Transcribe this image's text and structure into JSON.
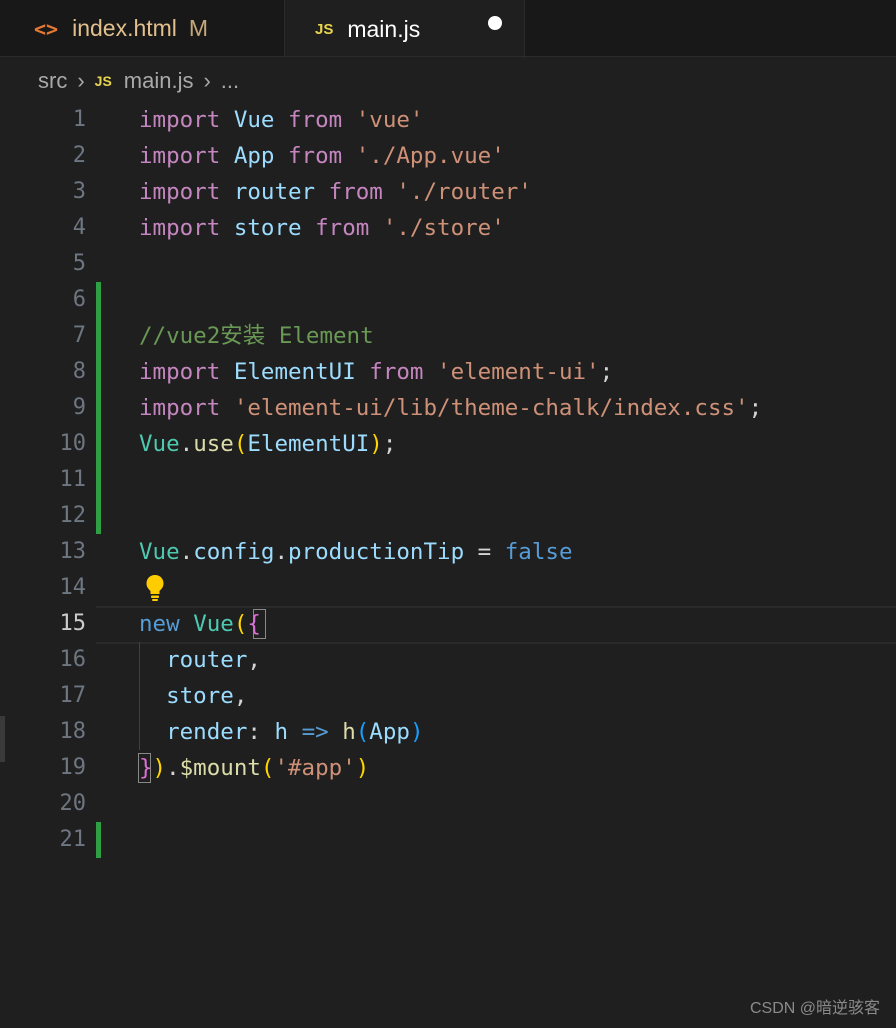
{
  "tabs": [
    {
      "icon": "html-icon",
      "glyph": "<>",
      "name": "index.html",
      "status": "M",
      "active": false
    },
    {
      "icon": "js-icon",
      "glyph": "JS",
      "name": "main.js",
      "dirty": true,
      "active": true
    }
  ],
  "breadcrumb": {
    "folder": "src",
    "js_glyph": "JS",
    "file": "main.js",
    "more": "..."
  },
  "editor": {
    "current_line": 15,
    "line_numbers": [
      "1",
      "2",
      "3",
      "4",
      "5",
      "6",
      "7",
      "8",
      "9",
      "10",
      "11",
      "12",
      "13",
      "14",
      "15",
      "16",
      "17",
      "18",
      "19",
      "20",
      "21"
    ],
    "lines": [
      [
        {
          "t": "import",
          "c": "kw"
        },
        {
          "t": " "
        },
        {
          "t": "Vue",
          "c": "id"
        },
        {
          "t": " "
        },
        {
          "t": "from",
          "c": "kw"
        },
        {
          "t": " "
        },
        {
          "t": "'vue'",
          "c": "str"
        }
      ],
      [
        {
          "t": "import",
          "c": "kw"
        },
        {
          "t": " "
        },
        {
          "t": "App",
          "c": "id"
        },
        {
          "t": " "
        },
        {
          "t": "from",
          "c": "kw"
        },
        {
          "t": " "
        },
        {
          "t": "'./App.vue'",
          "c": "str"
        }
      ],
      [
        {
          "t": "import",
          "c": "kw"
        },
        {
          "t": " "
        },
        {
          "t": "router",
          "c": "id"
        },
        {
          "t": " "
        },
        {
          "t": "from",
          "c": "kw"
        },
        {
          "t": " "
        },
        {
          "t": "'./router'",
          "c": "str"
        }
      ],
      [
        {
          "t": "import",
          "c": "kw"
        },
        {
          "t": " "
        },
        {
          "t": "store",
          "c": "id"
        },
        {
          "t": " "
        },
        {
          "t": "from",
          "c": "kw"
        },
        {
          "t": " "
        },
        {
          "t": "'./store'",
          "c": "str"
        }
      ],
      [],
      [],
      [
        {
          "t": "//vue2安装 Element",
          "c": "cm"
        }
      ],
      [
        {
          "t": "import",
          "c": "kw"
        },
        {
          "t": " "
        },
        {
          "t": "ElementUI",
          "c": "id"
        },
        {
          "t": " "
        },
        {
          "t": "from",
          "c": "kw"
        },
        {
          "t": " "
        },
        {
          "t": "'element-ui'",
          "c": "str"
        },
        {
          "t": ";"
        }
      ],
      [
        {
          "t": "import",
          "c": "kw"
        },
        {
          "t": " "
        },
        {
          "t": "'element-ui/lib/theme-chalk/index.css'",
          "c": "str"
        },
        {
          "t": ";"
        }
      ],
      [
        {
          "t": "Vue",
          "c": "cls"
        },
        {
          "t": "."
        },
        {
          "t": "use",
          "c": "fn"
        },
        {
          "t": "(",
          "c": "br1"
        },
        {
          "t": "ElementUI",
          "c": "id"
        },
        {
          "t": ")",
          "c": "br1"
        },
        {
          "t": ";"
        }
      ],
      [],
      [],
      [
        {
          "t": "Vue",
          "c": "cls"
        },
        {
          "t": "."
        },
        {
          "t": "config",
          "c": "id"
        },
        {
          "t": "."
        },
        {
          "t": "productionTip",
          "c": "id"
        },
        {
          "t": " = "
        },
        {
          "t": "false",
          "c": "blue"
        }
      ],
      [],
      [
        {
          "t": "new",
          "c": "blue"
        },
        {
          "t": " "
        },
        {
          "t": "Vue",
          "c": "cls"
        },
        {
          "t": "(",
          "c": "br1"
        },
        {
          "t": "{",
          "c": "br2"
        }
      ],
      [
        {
          "t": "  "
        },
        {
          "t": "router",
          "c": "id"
        },
        {
          "t": ","
        }
      ],
      [
        {
          "t": "  "
        },
        {
          "t": "store",
          "c": "id"
        },
        {
          "t": ","
        }
      ],
      [
        {
          "t": "  "
        },
        {
          "t": "render",
          "c": "id"
        },
        {
          "t": ": "
        },
        {
          "t": "h",
          "c": "id"
        },
        {
          "t": " "
        },
        {
          "t": "=>",
          "c": "blue"
        },
        {
          "t": " "
        },
        {
          "t": "h",
          "c": "fn"
        },
        {
          "t": "(",
          "c": "br3"
        },
        {
          "t": "App",
          "c": "id"
        },
        {
          "t": ")",
          "c": "br3"
        }
      ],
      [
        {
          "t": "}",
          "c": "br2"
        },
        {
          "t": ")",
          "c": "br1"
        },
        {
          "t": "."
        },
        {
          "t": "$mount",
          "c": "fn"
        },
        {
          "t": "(",
          "c": "br1"
        },
        {
          "t": "'#app'",
          "c": "str"
        },
        {
          "t": ")",
          "c": "br1"
        }
      ],
      [],
      []
    ]
  },
  "colors": {
    "keyword": "#c586c0",
    "identifier": "#9cdcfe",
    "string": "#ce9178",
    "comment": "#6a9955",
    "class": "#4ec9b0",
    "function": "#dcdcaa",
    "constant": "#569cd6",
    "gutter_added": "#2ea043"
  },
  "lightbulb_icon": "lightbulb-icon",
  "watermark": "CSDN @暗逆骇客"
}
